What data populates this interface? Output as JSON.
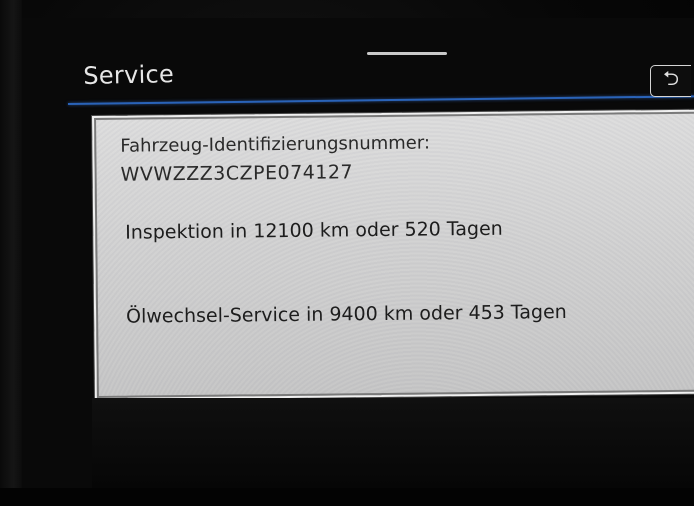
{
  "header": {
    "title": "Service",
    "accent_color": "#2a63b8"
  },
  "back_button": {
    "icon": "back-arrow-icon",
    "glyph": "⮌"
  },
  "info": {
    "vin_label": "Fahrzeug-Identifizierungsnummer:",
    "vin_value": "WVWZZZ3CZPE074127",
    "inspection": "Inspektion in 12100 km oder 520 Tagen",
    "oil_service": "Ölwechsel-Service in 9400 km oder 453 Tagen"
  }
}
